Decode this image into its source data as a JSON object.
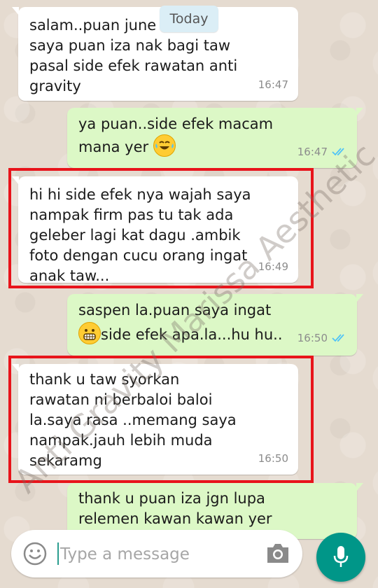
{
  "date_chip": "Today",
  "messages": [
    {
      "direction": "incoming",
      "text": "salam..puan  june\nsaya puan iza nak bagi taw\npasal side efek rawatan anti\ngravity",
      "time": "16:47",
      "highlighted": false
    },
    {
      "direction": "outgoing",
      "text": "ya puan..side efek macam\nmana yer",
      "emoji_end": "laughing-tears",
      "time": "16:47",
      "read": true
    },
    {
      "direction": "incoming",
      "text": "hi hi side efek nya wajah saya\nnampak firm pas tu tak ada\ngeleber lagi kat dagu .ambik\nfoto dengan cucu orang ingat\nanak taw...",
      "time": "16:49",
      "highlighted": true
    },
    {
      "direction": "outgoing",
      "text_line1": "saspen la.puan saya ingat",
      "text_line2": "side efek apa.la...hu hu..",
      "emoji_start": "grimacing",
      "time": "16:50",
      "read": true
    },
    {
      "direction": "incoming",
      "text": "thank u taw syorkan\nrawatan ni berbaloi baloi\nla.saya rasa ..memang saya\nnampak.jauh lebih muda\nsekaramg",
      "time": "16:50",
      "highlighted": true
    },
    {
      "direction": "outgoing",
      "text": "thank u puan iza jgn lupa\nrelemen kawan kawan yer"
    }
  ],
  "watermark": "Anti Gravity Marissa Aesthetic",
  "composer": {
    "placeholder": "Type a message"
  },
  "icons": {
    "emoji": "smiley-icon",
    "camera": "camera-icon",
    "send": "microphone-icon",
    "read_receipt": "double-check-icon"
  },
  "colors": {
    "incoming": "#ffffff",
    "outgoing": "#dcf8c6",
    "highlight": "#e8141b",
    "fab": "#009688",
    "read_tick": "#4fc3f7"
  }
}
